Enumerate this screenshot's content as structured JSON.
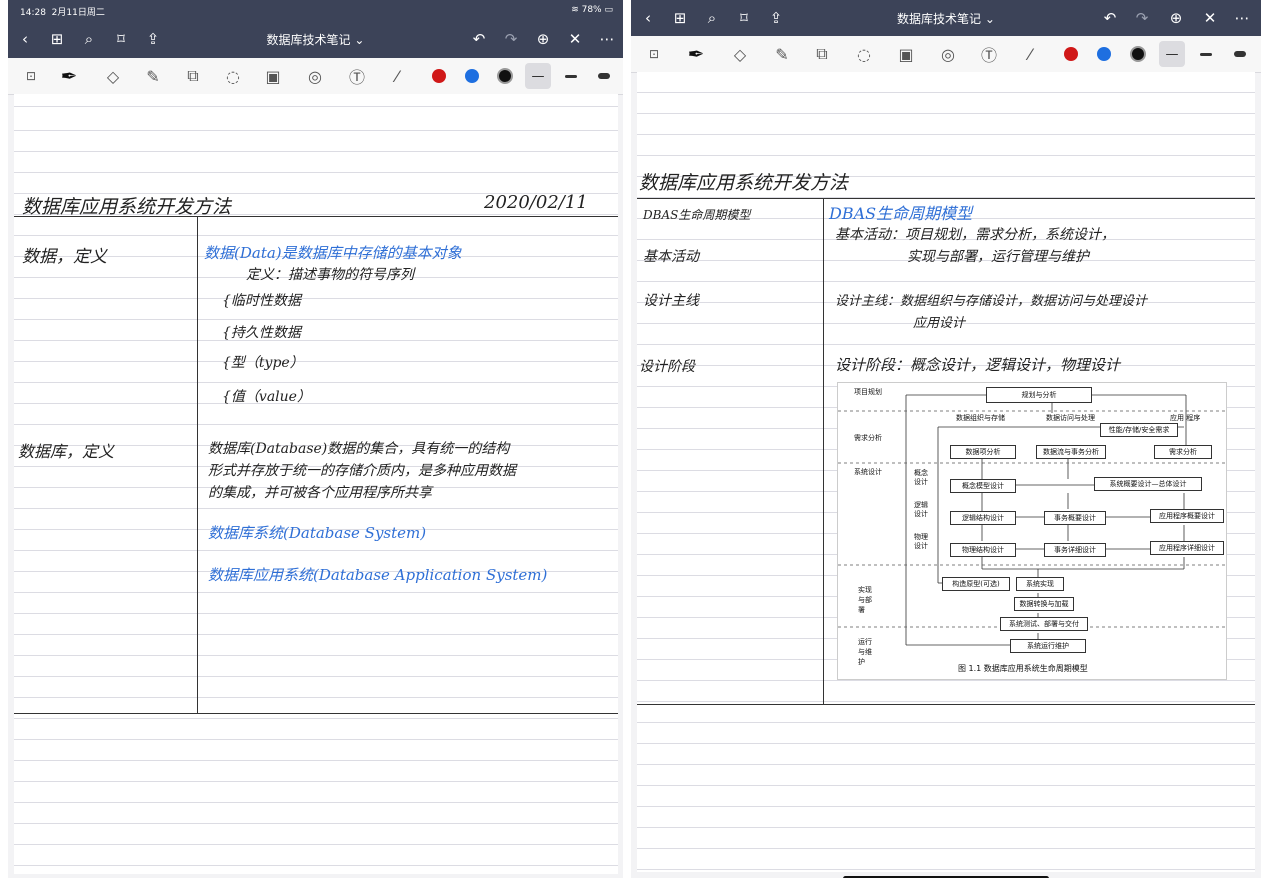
{
  "left": {
    "status": {
      "time": "14:28",
      "date": "2月11日周二",
      "battery": "78%"
    },
    "nav": {
      "title": "数据库技术笔记",
      "chevron": "⌄"
    },
    "note": {
      "heading": "数据库应用系统开发方法",
      "date": "2020/02/11",
      "rows": [
        {
          "key": "数据，定义",
          "lines": [
            "数据(Data)是数据库中存储的基本对象",
            "定义：描述事物的符号序列",
            "{临时性数据",
            "{持久性数据",
            "{型（type）",
            "{值（value）"
          ]
        },
        {
          "key": "数据库，定义",
          "lines": [
            "数据库(Database)数据的集合，具有统一的结构",
            "形式并存放于统一的存储介质内，是多种应用数据",
            "的集成，并可被各个应用程序所共享",
            "数据库系统(Database System)",
            "数据库应用系统(Database Application System)"
          ]
        }
      ]
    }
  },
  "right": {
    "nav": {
      "title": "数据库技术笔记",
      "chevron": "⌄"
    },
    "note": {
      "heading": "数据库应用系统开发方法",
      "rows": [
        {
          "key": "DBAS生命周期模型",
          "value": "DBAS生命周期模型"
        },
        {
          "key": "基本活动",
          "value": "基本活动：项目规划，需求分析，系统设计，",
          "value2": "实现与部署，运行管理与维护"
        },
        {
          "key": "设计主线",
          "value": "设计主线：数据组织与存储设计，数据访问与处理设计",
          "value2": "应用设计"
        },
        {
          "key": "设计阶段",
          "value": "设计阶段：概念设计，逻辑设计，物理设计"
        }
      ]
    },
    "diagram": {
      "caption": "图 1.1  数据库应用系统生命周期模型",
      "left_labels": [
        "项目规划",
        "需求分析",
        "系统设计",
        "实现与部署",
        "运行与维护"
      ],
      "sub_labels": [
        "概念设计",
        "逻辑设计",
        "物理设计"
      ],
      "top_labels": [
        "数据组织与存储",
        "数据访问与处理",
        "应用 程序"
      ],
      "boxes": {
        "plan": "规划与分析",
        "perf": "性能/存储/安全需求",
        "data_req": "数据项分析",
        "flow": "数据流与事务分析",
        "req": "需求分析",
        "concept": "概念模型设计",
        "sys_overview": "系统概要设计—总体设计",
        "logic": "逻辑结构设计",
        "txn_overview": "事务概要设计",
        "app_overview": "应用程序概要设计",
        "phys": "物理结构设计",
        "txn_detail": "事务详细设计",
        "app_detail": "应用程序详细设计",
        "proto": "构造原型(可选)",
        "impl": "系统实现",
        "load": "数据转换与加载",
        "test": "系统测试、部署与交付",
        "maint": "系统运行维护"
      }
    }
  }
}
